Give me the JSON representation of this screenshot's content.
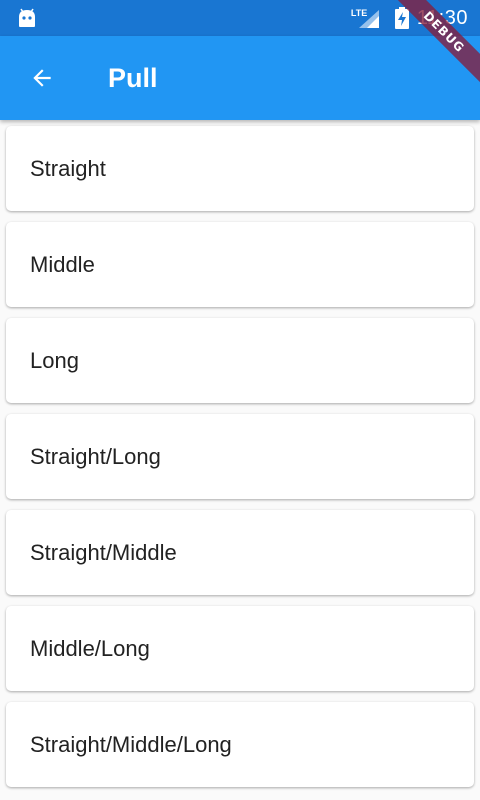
{
  "status_bar": {
    "time": "11:30",
    "network_label": "LTE",
    "color": "#1976D2"
  },
  "app_bar": {
    "title": "Pull",
    "back_icon": "arrow-back-icon",
    "color": "#2196F3"
  },
  "debug_banner": {
    "label": "DEBUG"
  },
  "list": {
    "items": [
      {
        "label": "Straight"
      },
      {
        "label": "Middle"
      },
      {
        "label": "Long"
      },
      {
        "label": "Straight/Long"
      },
      {
        "label": "Straight/Middle"
      },
      {
        "label": "Middle/Long"
      },
      {
        "label": "Straight/Middle/Long"
      }
    ]
  }
}
